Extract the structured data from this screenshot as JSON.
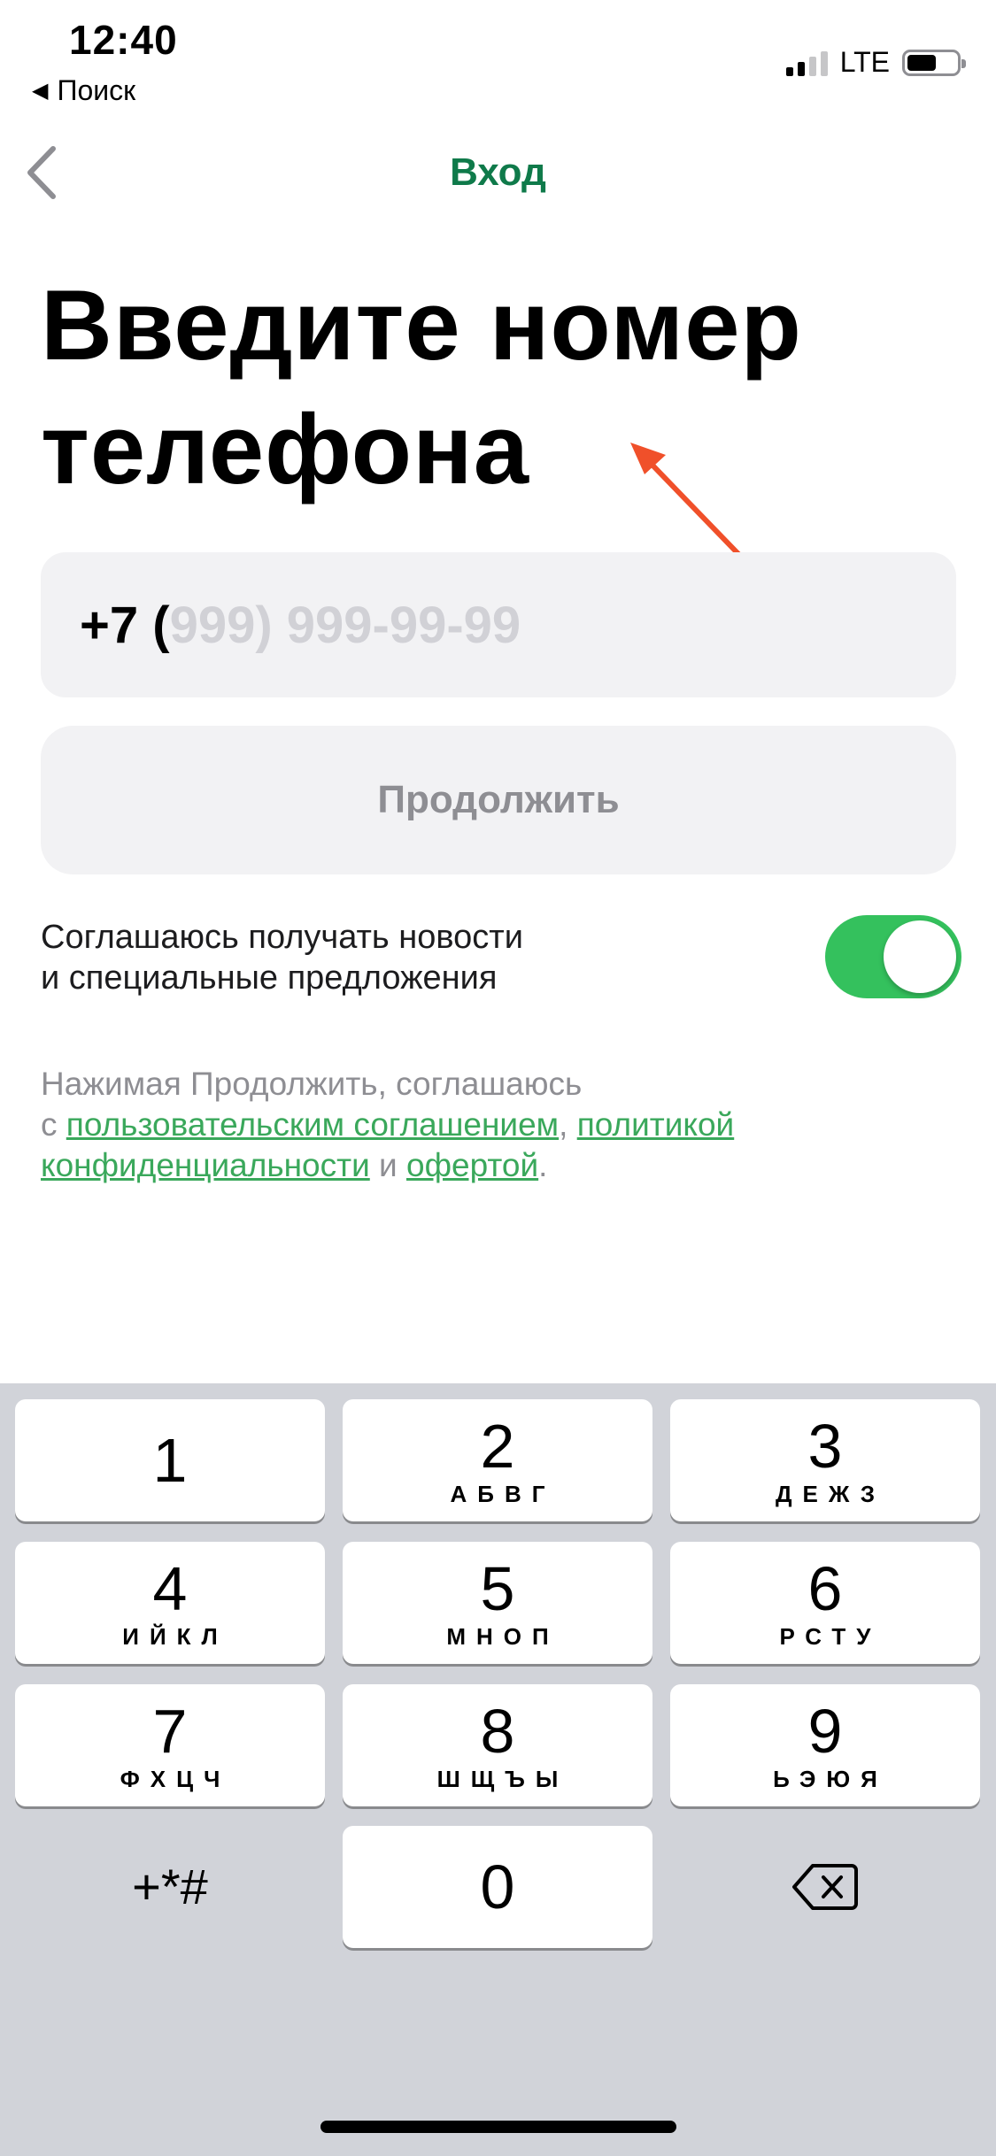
{
  "status_bar": {
    "time": "12:40",
    "back_app": "Поиск",
    "network": "LTE"
  },
  "nav": {
    "title": "Вход"
  },
  "heading": "Введите номер телефона",
  "phone": {
    "prefix": "+7 (",
    "placeholder": "999) 999-99-99"
  },
  "continue_label": "Продолжить",
  "consent": {
    "line1": "Соглашаюсь получать новости",
    "line2": "и специальные предложения",
    "enabled": true
  },
  "legal": {
    "part1": "Нажимая Продолжить, соглашаюсь",
    "part2": "с ",
    "link_agreement": "пользовательским соглашением",
    "sep": ", ",
    "link_policy_1": "политикой",
    "link_policy_2": "конфиденциальности",
    "and": " и ",
    "link_offer": "офертой",
    "end": "."
  },
  "keyboard": {
    "keys": [
      {
        "num": "1",
        "letters": ""
      },
      {
        "num": "2",
        "letters": "АБВГ"
      },
      {
        "num": "3",
        "letters": "ДЕЖЗ"
      },
      {
        "num": "4",
        "letters": "ИЙКЛ"
      },
      {
        "num": "5",
        "letters": "МНОП"
      },
      {
        "num": "6",
        "letters": "РСТУ"
      },
      {
        "num": "7",
        "letters": "ФХЦЧ"
      },
      {
        "num": "8",
        "letters": "ШЩЪЫ"
      },
      {
        "num": "9",
        "letters": "ЬЭЮЯ"
      },
      {
        "num": "0",
        "letters": ""
      }
    ],
    "symbols": "+*#"
  },
  "colors": {
    "accent": "#0f7a4a",
    "toggle_on": "#34c15d",
    "link": "#3aa85b",
    "arrow": "#f0502a"
  }
}
